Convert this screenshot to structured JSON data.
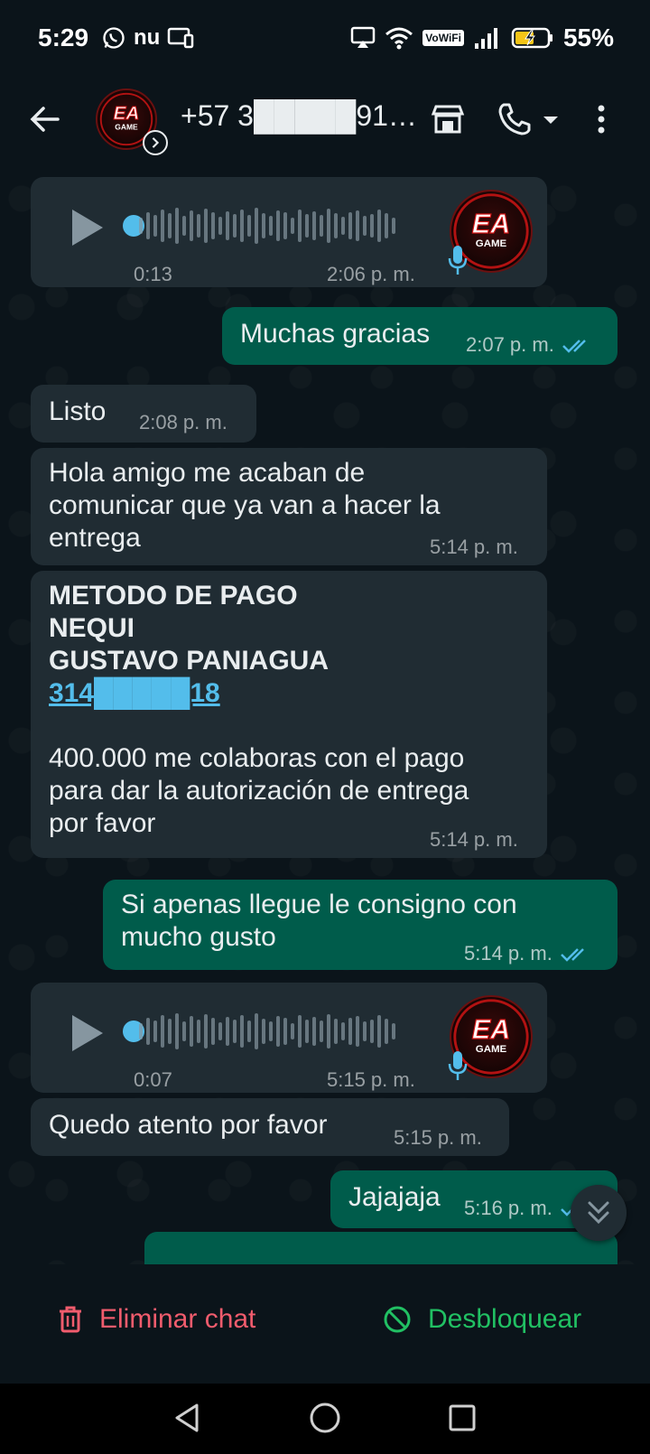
{
  "status_bar": {
    "time": "5:29",
    "carrier_icon": "nu",
    "vowifi_label": "VoWiFi",
    "battery_percent": "55%"
  },
  "header": {
    "contact_name": "+57 3█████91…",
    "avatar_text": "EA GAME"
  },
  "messages": [
    {
      "type": "voice",
      "direction": "in",
      "duration": "0:13",
      "time": "2:06 p. m."
    },
    {
      "type": "text",
      "direction": "out",
      "text": "Muchas gracias",
      "time": "2:07 p. m.",
      "status": "read"
    },
    {
      "type": "text",
      "direction": "in",
      "text": "Listo",
      "time": "2:08 p. m."
    },
    {
      "type": "text",
      "direction": "in",
      "lines": [
        "Hola amigo me acaban de",
        "comunicar que ya van a hacer la",
        "entrega"
      ],
      "time": "5:14 p. m."
    },
    {
      "type": "text",
      "direction": "in",
      "bold_lines": [
        "METODO DE PAGO",
        "NEQUI",
        "GUSTAVO PANIAGUA"
      ],
      "phone": "314█████18",
      "lines": [
        "400.000 me colaboras con el pago",
        "para dar la autorización de entrega",
        "por favor"
      ],
      "time": "5:14 p. m."
    },
    {
      "type": "text",
      "direction": "out",
      "lines": [
        "Si apenas llegue le consigno con",
        "mucho gusto"
      ],
      "time": "5:14 p. m.",
      "status": "read"
    },
    {
      "type": "voice",
      "direction": "in",
      "duration": "0:07",
      "time": "5:15 p. m."
    },
    {
      "type": "text",
      "direction": "in",
      "text": "Quedo atento por favor",
      "time": "5:15 p. m."
    },
    {
      "type": "text",
      "direction": "out",
      "text": "Jajajaja",
      "time": "5:16 p. m.",
      "status": "read"
    }
  ],
  "actions": {
    "delete_label": "Eliminar chat",
    "unblock_label": "Desbloquear"
  },
  "colors": {
    "background": "#0b141a",
    "incoming_bubble": "#202c33",
    "outgoing_bubble": "#005c4b",
    "read_tick": "#53bdeb",
    "delete": "#f15c6d",
    "unblock": "#21c063"
  },
  "icons": [
    "whatsapp-icon",
    "cast-icon",
    "wifi-icon",
    "signal-icon",
    "battery-icon",
    "back-arrow-icon",
    "store-icon",
    "phone-call-icon",
    "more-vert-icon",
    "play-icon",
    "mic-icon",
    "double-check-icon",
    "scroll-down-icon",
    "trash-icon",
    "unblock-icon",
    "nav-back-icon",
    "nav-home-icon",
    "nav-recents-icon"
  ]
}
